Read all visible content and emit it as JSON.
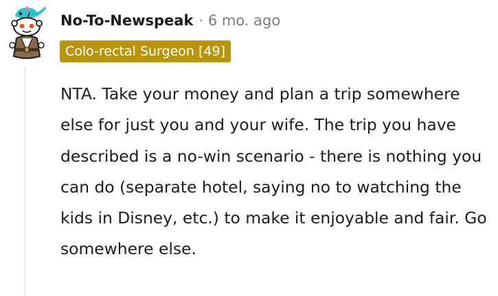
{
  "comment": {
    "username": "No-To-Newspeak",
    "separator": "·",
    "age": "6 mo. ago",
    "flair": "Colo-rectal Surgeon [49]",
    "body": "NTA. Take your money and plan a trip somewhere else for just you and your wife. The trip you have described is a no-win scenario - there is nothing you can do (separate hotel, saying no to watching the kids in Disney, etc.) to make it enjoyable and fair. Go somewhere else."
  },
  "colors": {
    "flair_background": "#b8950a",
    "flair_text": "#ffffff",
    "username": "#1c1c1c",
    "meta_muted": "#7c7c7c",
    "thread_line": "#ebedef",
    "avatar_accent": "#ff4500",
    "avatar_hat": "#2ec4c8"
  },
  "icons": {
    "avatar": "snoo-avatar-with-narwhal-hat"
  }
}
